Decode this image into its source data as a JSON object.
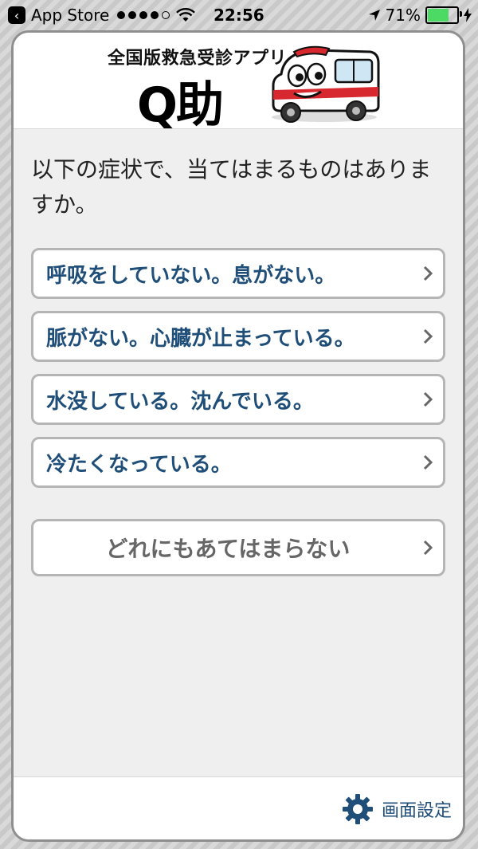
{
  "status_bar": {
    "back_app": "App Store",
    "time": "22:56",
    "battery": "71%",
    "battery_level": 0.71
  },
  "header": {
    "subtitle": "全国版救急受診アプリ",
    "title": "Q助"
  },
  "question": "以下の症状で、当てはまるものはありますか。",
  "options": [
    {
      "label": "呼吸をしていない。息がない。"
    },
    {
      "label": "脈がない。心臓が止まっている。"
    },
    {
      "label": "水没している。沈んでいる。"
    },
    {
      "label": "冷たくなっている。"
    }
  ],
  "none_option": {
    "label": "どれにもあてはまらない"
  },
  "footer": {
    "settings_label": "画面設定"
  },
  "colors": {
    "accent": "#1f4e79",
    "battery": "#4cd964",
    "mascot_red": "#d7282f"
  }
}
